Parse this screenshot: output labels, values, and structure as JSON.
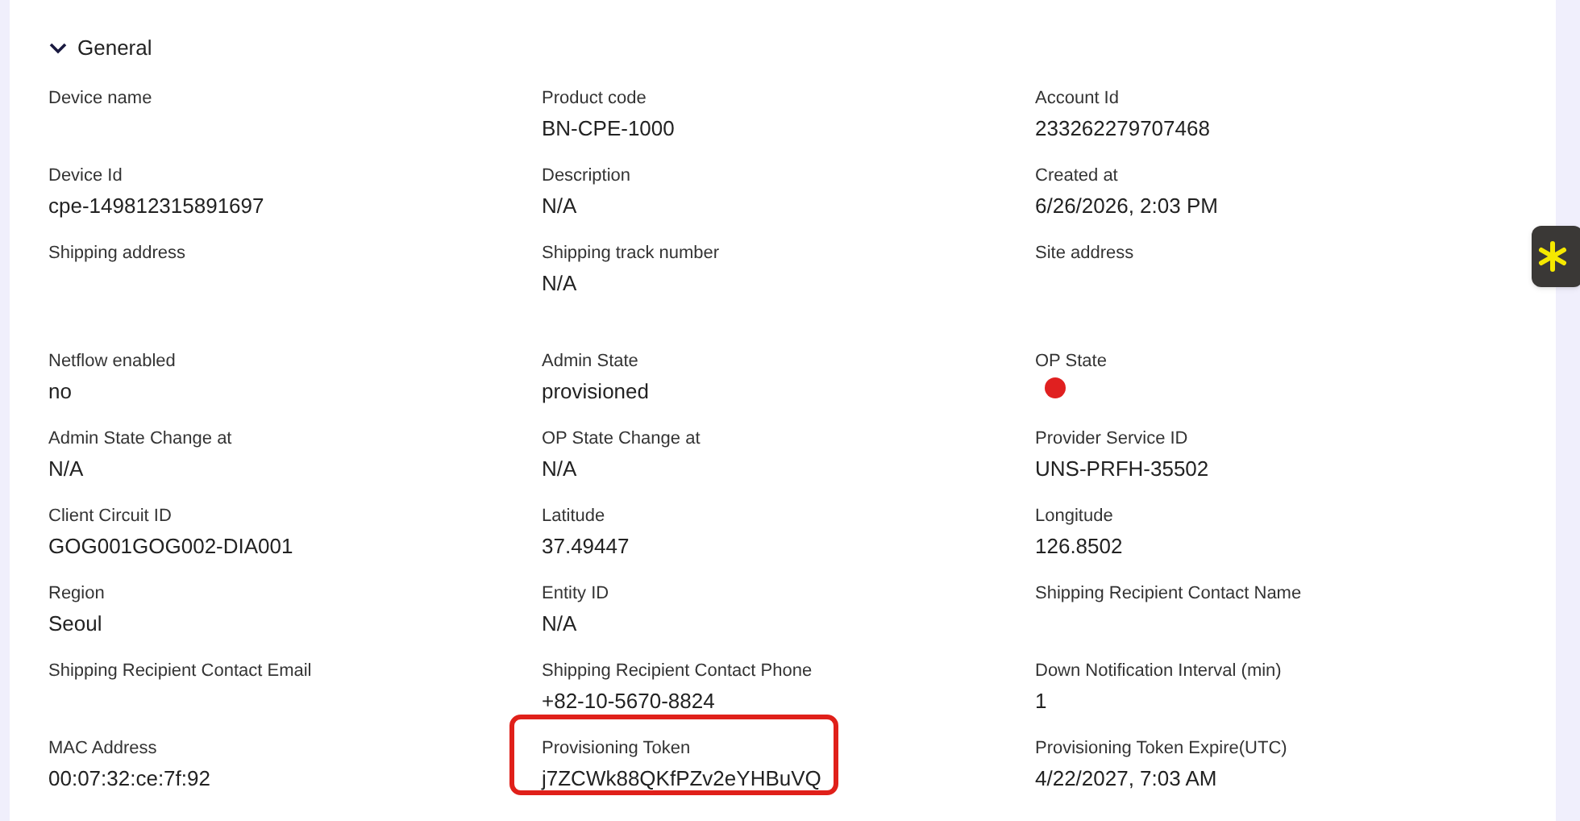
{
  "section": {
    "title": "General",
    "expanded": true
  },
  "fields": [
    {
      "label": "Device name",
      "kind": "text"
    },
    {
      "label": "Product code",
      "kind": "text",
      "value": "BN-CPE-1000"
    },
    {
      "label": "Account Id",
      "kind": "text",
      "value": "233262279707468"
    },
    {
      "label": "Device Id",
      "kind": "text",
      "value": "cpe-149812315891697"
    },
    {
      "label": "Description",
      "kind": "text",
      "value": "N/A"
    },
    {
      "label": "Created at",
      "kind": "text",
      "value": "6/26/2026, 2:03 PM"
    },
    {
      "label": "Shipping address",
      "kind": "text",
      "tall": true
    },
    {
      "label": "Shipping track number",
      "kind": "text",
      "value": "N/A",
      "tall": true
    },
    {
      "label": "Site address",
      "kind": "text",
      "tall": true
    },
    {
      "label": "Netflow enabled",
      "kind": "text",
      "value": "no"
    },
    {
      "label": "Admin State",
      "kind": "text",
      "value": "provisioned"
    },
    {
      "label": "OP State",
      "kind": "dot",
      "color": "#e02020"
    },
    {
      "label": "Admin State Change at",
      "kind": "text",
      "value": "N/A"
    },
    {
      "label": "OP State Change at",
      "kind": "text",
      "value": "N/A"
    },
    {
      "label": "Provider Service ID",
      "kind": "text",
      "value": "UNS-PRFH-35502"
    },
    {
      "label": "Client Circuit ID",
      "kind": "text",
      "value": "GOG001GOG002-DIA001"
    },
    {
      "label": "Latitude",
      "kind": "text",
      "value": "37.49447"
    },
    {
      "label": "Longitude",
      "kind": "text",
      "value": "126.8502"
    },
    {
      "label": "Region",
      "kind": "text",
      "value": "Seoul"
    },
    {
      "label": "Entity ID",
      "kind": "text",
      "value": "N/A"
    },
    {
      "label": "Shipping Recipient Contact Name",
      "kind": "text"
    },
    {
      "label": "Shipping Recipient Contact Email",
      "kind": "text"
    },
    {
      "label": "Shipping Recipient Contact Phone",
      "kind": "text",
      "value": "+82-10-5670-8824"
    },
    {
      "label": "Down Notification Interval (min)",
      "kind": "text",
      "value": "1"
    },
    {
      "label": "MAC Address",
      "kind": "text",
      "value": "00:07:32:ce:7f:92"
    },
    {
      "label": "Provisioning Token",
      "kind": "text",
      "value": "j7ZCWk88QKfPZv2eYHBuVQ",
      "highlighted": true
    },
    {
      "label": "Provisioning Token Expire(UTC)",
      "kind": "text",
      "value": "4/22/2027, 7:03 AM"
    }
  ]
}
